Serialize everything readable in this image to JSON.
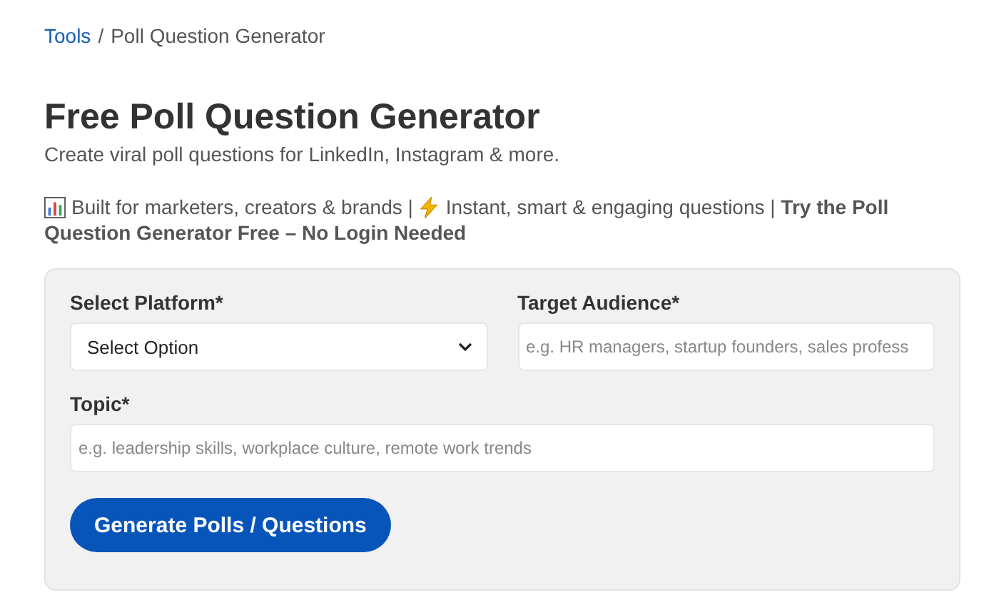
{
  "breadcrumbs": [
    {
      "label": "Tools",
      "link": true
    },
    {
      "label": "Poll Question Generator",
      "link": false
    }
  ],
  "breadcrumb_separator": "/",
  "title": "Free Poll Question Generator",
  "subtitle": "Create viral poll questions for LinkedIn, Instagram & more.",
  "intro_lines": [
    [
      {
        "kind": "chart"
      },
      {
        "kind": "text",
        "text": "Built for marketers, creators & brands |"
      },
      {
        "kind": "lightning"
      },
      {
        "kind": "text",
        "text": "Instant, smart & engaging questions | **Try the Poll**"
      }
    ],
    [
      {
        "kind": "text",
        "text": "Question Generator Free – No Login Needed",
        "bold": true
      }
    ]
  ],
  "form": {
    "fields": [
      {
        "kind": "select",
        "label": "Select Platform*",
        "value": "Select Option",
        "wide": false
      },
      {
        "kind": "text",
        "label": "Target Audience*",
        "placeholder": "e.g. HR managers, startup founders, sales profess",
        "wide": false
      },
      {
        "kind": "text",
        "label": "Topic*",
        "placeholder": "e.g. leadership skills, workplace culture, remote work trends",
        "wide": true
      }
    ],
    "submit": "Generate Polls / Questions"
  }
}
